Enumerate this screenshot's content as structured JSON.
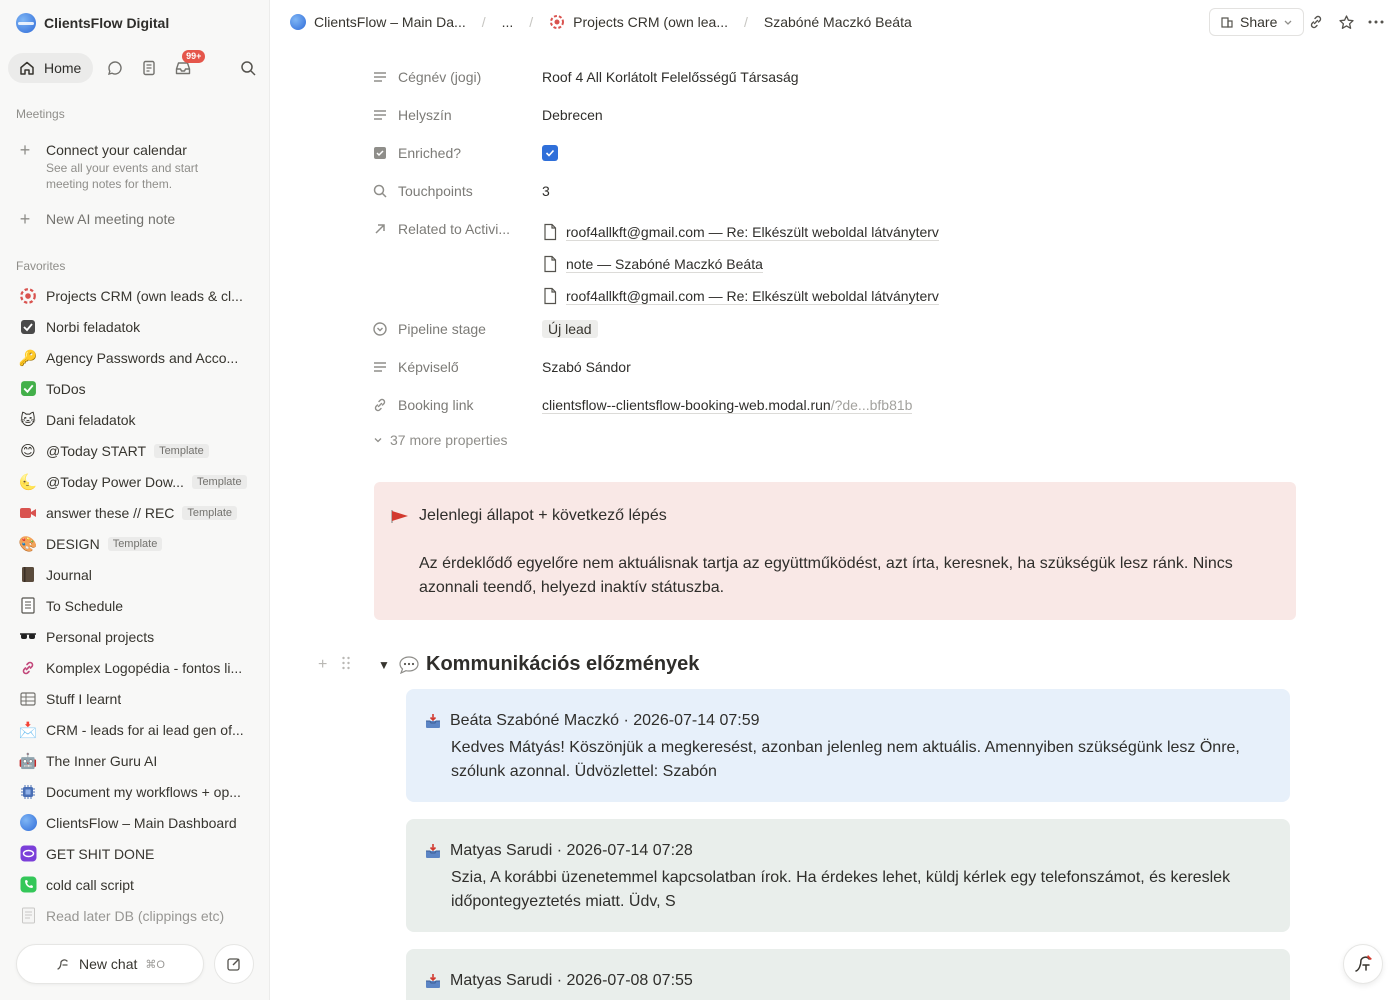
{
  "workspace": {
    "name": "ClientsFlow Digital"
  },
  "topnav": {
    "home_label": "Home",
    "inbox_badge": "99+"
  },
  "meetings": {
    "section_label": "Meetings",
    "connect_title": "Connect your calendar",
    "connect_sub": "See all your events and start meeting notes for them.",
    "new_note": "New AI meeting note"
  },
  "favorites": {
    "section_label": "Favorites",
    "items": [
      {
        "label": "Projects CRM (own leads & cl...",
        "icon": "crm-ring-icon"
      },
      {
        "label": "Norbi feladatok",
        "icon": "checkbox-icon"
      },
      {
        "label": "Agency Passwords and Acco...",
        "icon": "key-icon"
      },
      {
        "label": "ToDos",
        "icon": "check-mark-icon"
      },
      {
        "label": "Dani feladatok",
        "icon": "cat-face-icon"
      },
      {
        "label": "@Today START",
        "icon": "smile-icon",
        "tag": "Template"
      },
      {
        "label": "@Today Power Dow...",
        "icon": "moon-icon",
        "tag": "Template"
      },
      {
        "label": "answer these // REC",
        "icon": "video-camera-icon",
        "tag": "Template"
      },
      {
        "label": "DESIGN",
        "icon": "palette-icon",
        "tag": "Template"
      },
      {
        "label": "Journal",
        "icon": "notebook-icon"
      },
      {
        "label": "To Schedule",
        "icon": "ledger-icon"
      },
      {
        "label": "Personal projects",
        "icon": "sunglasses-icon"
      },
      {
        "label": "Komplex Logopédia - fontos li...",
        "icon": "link-icon"
      },
      {
        "label": "Stuff I learnt",
        "icon": "table-icon"
      },
      {
        "label": "CRM - leads for ai lead gen of...",
        "icon": "envelope-icon"
      },
      {
        "label": "The Inner Guru AI",
        "icon": "robot-icon"
      },
      {
        "label": "Document my workflows + op...",
        "icon": "chip-icon"
      },
      {
        "label": "ClientsFlow – Main Dashboard",
        "icon": "globe-logo-icon"
      },
      {
        "label": "GET SHIT DONE",
        "icon": "eye-logo-icon"
      },
      {
        "label": "cold call script",
        "icon": "phone-icon"
      },
      {
        "label": "Read later DB (clippings etc)",
        "icon": "document-icon"
      }
    ]
  },
  "chat": {
    "new_chat_label": "New chat",
    "shortcut": "⌘O"
  },
  "breadcrumb": {
    "root": "ClientsFlow – Main Da...",
    "ellipsis": "...",
    "parent": "Projects CRM (own lea...",
    "current": "Szabóné Maczkó Beáta"
  },
  "toolbar": {
    "share_label": "Share"
  },
  "properties": [
    {
      "key": "Cégnév (jogi)",
      "value": "Roof 4 All Korlátolt Felelősségű Társaság",
      "icon": "text-lines-icon"
    },
    {
      "key": "Helyszín",
      "value": "Debrecen",
      "icon": "text-lines-icon"
    },
    {
      "key": "Enriched?",
      "value": "true",
      "icon": "checkbox-prop-icon"
    },
    {
      "key": "Touchpoints",
      "value": "3",
      "icon": "search-icon"
    }
  ],
  "related": {
    "key": "Related to Activi...",
    "items": [
      "roof4allkft@gmail.com — Re: Elkészült weboldal látványterv",
      "note — Szabóné Maczkó Beáta",
      "roof4allkft@gmail.com — Re: Elkészült weboldal látványterv"
    ]
  },
  "pipeline": {
    "key": "Pipeline stage",
    "value": "Új lead"
  },
  "rep": {
    "key": "Képviselő",
    "value": "Szabó Sándor"
  },
  "booking": {
    "key": "Booking link",
    "value_main": "clientsflow--clientsflow-booking-web.modal.run",
    "value_tail": "/?de...bfb81b"
  },
  "more_props": "37 more properties",
  "callout": {
    "title": "Jelenlegi állapot + következő lépés",
    "body": "Az érdeklődő egyelőre nem aktuálisnak tartja az együttműködést, azt írta, keresnek, ha szükségük lesz ránk. Nincs azonnali teendő, helyezd inaktív státuszba.",
    "bg_color": "#f9e8e6"
  },
  "history": {
    "heading": "Kommunikációs előzmények",
    "messages": [
      {
        "header": "Beáta Szabóné Maczkó · 2026-07-14 07:59",
        "body": "Kedves Mátyás! Köszönjük a megkeresést, azonban jelenleg nem aktuális. Amennyiben szükségünk lesz Önre, szólunk azonnal. Üdvözlettel: Szabón",
        "bg_color": "#e7f0fa"
      },
      {
        "header": "Matyas Sarudi · 2026-07-14 07:28",
        "body": "Szia, A korábbi üzenetemmel kapcsolatban írok. Ha érdekes lehet, küldj kérlek egy telefonszámot, és kereslek időpontegyeztetés miatt. Üdv, S",
        "bg_color": "#e9eeeb"
      },
      {
        "header": "Matyas Sarudi · 2026-07-08 07:55",
        "body": "",
        "bg_color": "#e9eeeb"
      }
    ]
  }
}
